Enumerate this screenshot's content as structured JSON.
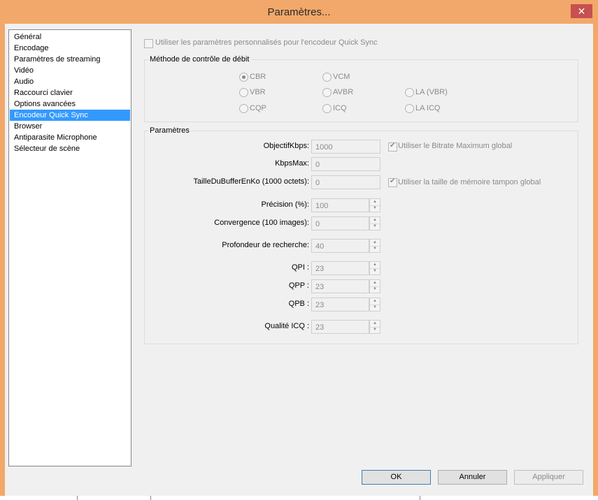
{
  "window": {
    "title": "Paramètres...",
    "close_glyph": "✕"
  },
  "sidebar": {
    "items": [
      {
        "label": "Général"
      },
      {
        "label": "Encodage"
      },
      {
        "label": "Paramètres de streaming"
      },
      {
        "label": "Vidéo"
      },
      {
        "label": "Audio"
      },
      {
        "label": "Raccourci clavier"
      },
      {
        "label": "Options avancées"
      },
      {
        "label": "Encodeur Quick Sync"
      },
      {
        "label": "Browser"
      },
      {
        "label": "Antiparasite Microphone"
      },
      {
        "label": "Sélecteur de scène"
      }
    ],
    "selected": "Encodeur Quick Sync"
  },
  "main": {
    "custom_settings_label": "Utiliser les paramètres personnalisés pour l'encodeur Quick Sync",
    "rate_control": {
      "title": "Méthode de contrôle de débit",
      "options": [
        "CBR",
        "VCM",
        "VBR",
        "AVBR",
        "LA (VBR)",
        "CQP",
        "ICQ",
        "LA ICQ"
      ],
      "selected": "CBR"
    },
    "params": {
      "title": "Paramètres",
      "objectif_label": "ObjectifKbps:",
      "objectif_value": "1000",
      "use_global_bitrate_label": "Utiliser le Bitrate Maximum global",
      "kbpsmax_label": "KbpsMax:",
      "kbpsmax_value": "0",
      "buffer_label": "TailleDuBufferEnKo (1000 octets):",
      "buffer_value": "0",
      "use_global_buffer_label": "Utiliser la taille de mémoire tampon global",
      "precision_label": "Précision (%):",
      "precision_value": "100",
      "convergence_label": "Convergence (100 images):",
      "convergence_value": "0",
      "profondeur_label": "Profondeur de recherche:",
      "profondeur_value": "40",
      "qpi_label": "QPI :",
      "qpi_value": "23",
      "qpp_label": "QPP :",
      "qpp_value": "23",
      "qpb_label": "QPB :",
      "qpb_value": "23",
      "icq_label": "Qualité ICQ :",
      "icq_value": "23"
    }
  },
  "buttons": {
    "ok": "OK",
    "cancel": "Annuler",
    "apply": "Appliquer"
  }
}
